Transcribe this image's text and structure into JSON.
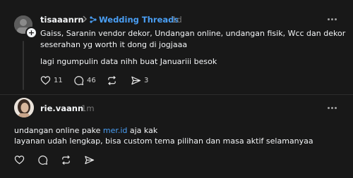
{
  "post1": {
    "username": "tisaaanrn",
    "topic": "Wedding Threads",
    "time": "1d",
    "lines": [
      "Gaiss, Saranin vendor dekor, Undangan online, undangan fisik, Wcc dan dekor",
      "seserahan yg worth it dong di jogjaaa"
    ],
    "paragraph2": "lagi ngumpulin data nihh buat Januariii besok",
    "likes": "11",
    "comments": "46",
    "shares": "3"
  },
  "post2": {
    "username": "rie.vaann",
    "time": "1m",
    "line1_before": "undangan online pake ",
    "line1_link": "mer.id",
    "line1_after": " aja kak",
    "line2": "layanan udah lengkap, bisa custom tema pilihan dan masa aktif selamanyaa"
  },
  "icons": {
    "avatar1": "avatar-icon",
    "follow": "plus-icon",
    "chevron": "chevron-right-icon",
    "topic": "topic-tag-icon",
    "more": "more-options-icon",
    "like": "heart-icon",
    "comment": "comment-icon",
    "repost": "repost-icon",
    "share": "send-icon"
  },
  "colors": {
    "background": "#181818",
    "text": "#f3f5f7",
    "accent": "#4a9ff5",
    "muted": "#777777"
  }
}
